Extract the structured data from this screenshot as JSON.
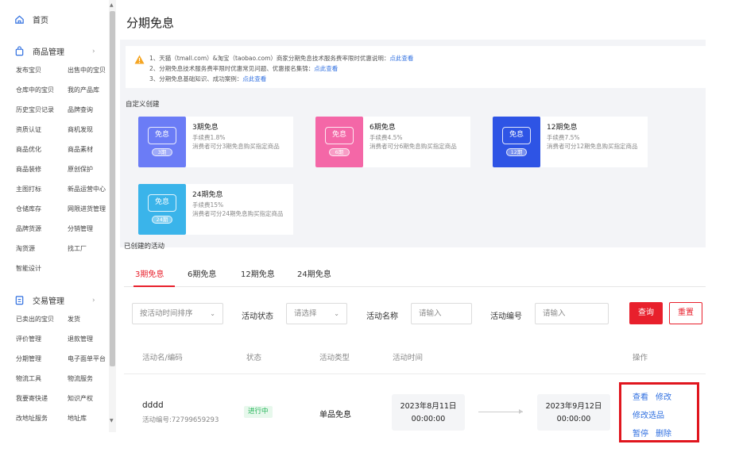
{
  "sidebar": {
    "home": "首页",
    "group1": {
      "title": "商品管理",
      "items": [
        [
          "发布宝贝",
          "出售中的宝贝"
        ],
        [
          "仓库中的宝贝",
          "我的产品库"
        ],
        [
          "历史宝贝记录",
          "品牌查询"
        ],
        [
          "资质认证",
          "商机发现"
        ],
        [
          "商品优化",
          "商品素材"
        ],
        [
          "商品装修",
          "原创保护"
        ],
        [
          "主图打标",
          "新品运营中心"
        ],
        [
          "仓储库存",
          "网限进货管理"
        ],
        [
          "品牌货源",
          "分销管理"
        ],
        [
          "淘货源",
          "找工厂"
        ],
        [
          "智能设计",
          ""
        ]
      ]
    },
    "group2": {
      "title": "交易管理",
      "items": [
        [
          "已卖出的宝贝",
          "发货"
        ],
        [
          "评价管理",
          "退款管理"
        ],
        [
          "分期管理",
          "电子面单平台"
        ],
        [
          "物流工具",
          "物流服务"
        ],
        [
          "我要寄快递",
          "知识产权"
        ],
        [
          "改地址服务",
          "地址库"
        ]
      ]
    }
  },
  "page": {
    "title": "分期免息",
    "notice": {
      "line1": "1、天猫（tmall.com）&淘宝（taobao.com）商家分期免息技术服务费率限时优惠说明：",
      "line2": "2、分期免息技术服务费率限时优惠常见问题、优惠报名集锦：",
      "line3": "3、分期免息基础知识、成功案例：",
      "link": "点此查看"
    },
    "custom_create_label": "自定义创建",
    "cards": [
      {
        "title": "3期免息",
        "fee": "手续费1.8%",
        "desc": "消费者可分3期免息购买指定商品",
        "icon": "免息",
        "pill": "3期",
        "color": "#6b7cf6"
      },
      {
        "title": "6期免息",
        "fee": "手续费4.5%",
        "desc": "消费者可分6期免息购买指定商品",
        "icon": "免息",
        "pill": "6期",
        "color": "#f467a7"
      },
      {
        "title": "12期免息",
        "fee": "手续费7.5%",
        "desc": "消费者可分12期免息购买指定商品",
        "icon": "免息",
        "pill": "12期",
        "color": "#2e54e5"
      },
      {
        "title": "24期免息",
        "fee": "手续费15%",
        "desc": "消费者可分24期免息购买指定商品",
        "icon": "免息",
        "pill": "24期",
        "color": "#3ab4ea"
      }
    ],
    "created_label": "已创建的活动",
    "tabs": [
      "3期免息",
      "6期免息",
      "12期免息",
      "24期免息"
    ],
    "filters": {
      "sort_placeholder": "按活动时间排序",
      "status_label": "活动状态",
      "status_placeholder": "请选择",
      "name_label": "活动名称",
      "name_placeholder": "请输入",
      "code_label": "活动编号",
      "code_placeholder": "请输入",
      "query": "查询",
      "reset": "重置"
    },
    "table": {
      "headers": [
        "活动名/编码",
        "状态",
        "活动类型",
        "活动时间",
        "操作"
      ],
      "row": {
        "name": "dddd",
        "code": "活动编号:72799659293",
        "status": "进行中",
        "type": "单品免息",
        "start_date": "2023年8月11日",
        "start_time": "00:00:00",
        "end_date": "2023年9月12日",
        "end_time": "00:00:00",
        "ops": {
          "view": "查看",
          "edit": "修改",
          "edit_items": "修改选品",
          "pause": "暂停",
          "delete": "删除"
        }
      }
    }
  }
}
